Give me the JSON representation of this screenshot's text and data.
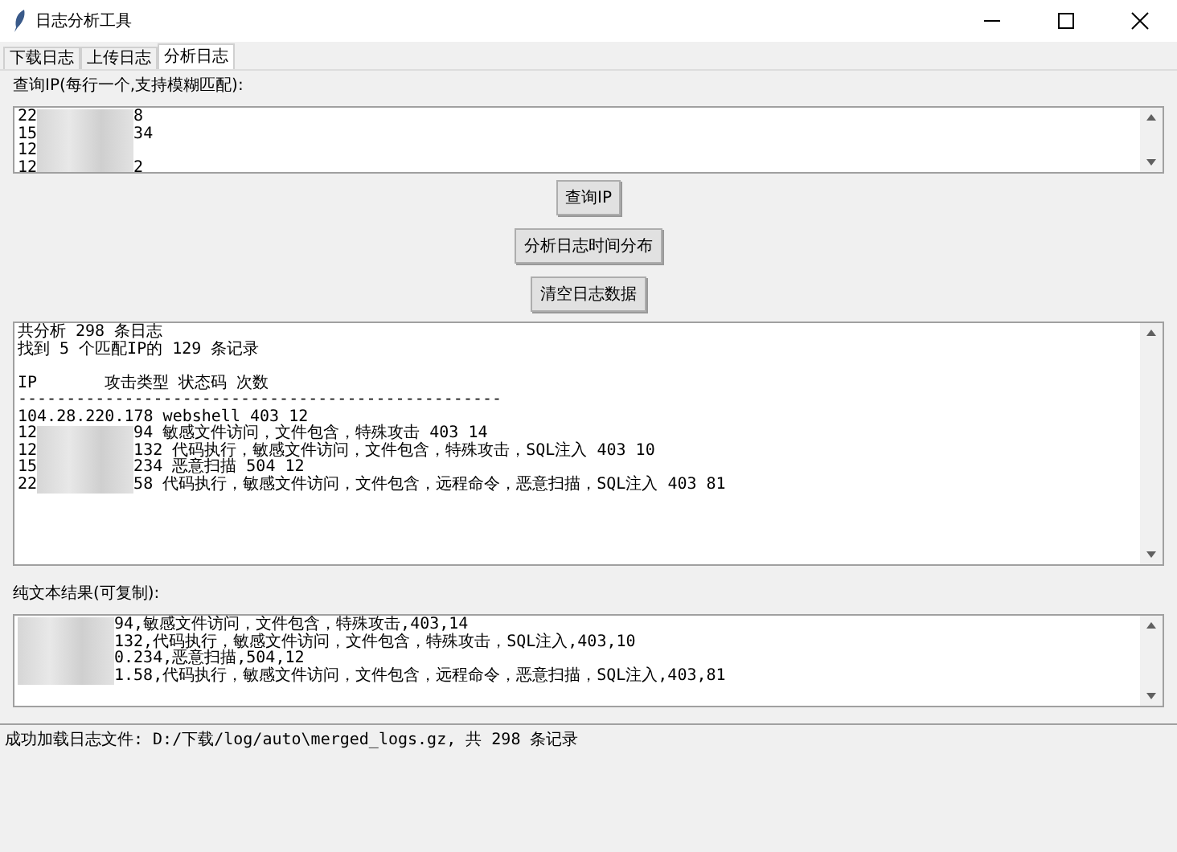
{
  "window": {
    "title": "日志分析工具"
  },
  "tabs": [
    {
      "label": "下载日志",
      "selected": false
    },
    {
      "label": "上传日志",
      "selected": false
    },
    {
      "label": "分析日志",
      "selected": true
    }
  ],
  "ip_query": {
    "label": "查询IP(每行一个,支持模糊匹配):",
    "lines": [
      {
        "head": "22",
        "redacted": true,
        "tail": "8"
      },
      {
        "head": "15",
        "redacted": true,
        "tail": "34"
      },
      {
        "head": "12",
        "redacted": true
      },
      {
        "head": "12",
        "redacted": true,
        "tail": "2"
      }
    ]
  },
  "buttons": [
    "查询IP",
    "分析日志时间分布",
    "清空日志数据"
  ],
  "results": {
    "lines": [
      {
        "head": "共分析 298 条日志"
      },
      {
        "head": "找到 5 个匹配IP的 129 条记录"
      },
      {
        "blank_before": true,
        "head": "IP       攻击类型 状态码 次数"
      },
      {
        "head": "--------------------------------------------------"
      },
      {
        "head": "104.28.220.178 webshell 403 12"
      },
      {
        "head": "12",
        "redacted": true,
        "tail": "94 敏感文件访问，文件包含，特殊攻击 403 14"
      },
      {
        "head": "12",
        "redacted": true,
        "tail": "132 代码执行，敏感文件访问，文件包含，特殊攻击，SQL注入 403 10"
      },
      {
        "head": "15",
        "redacted": true,
        "tail": "234 恶意扫描 504 12"
      },
      {
        "head": "22",
        "redacted": true,
        "tail": "58 代码执行，敏感文件访问，文件包含，远程命令，恶意扫描，SQL注入 403 81"
      }
    ]
  },
  "plain_text": {
    "label": "纯文本结果(可复制):",
    "lines": [
      {
        "redacted": true,
        "tail": "94,敏感文件访问，文件包含，特殊攻击,403,14"
      },
      {
        "redacted": true,
        "tail": "132,代码执行，敏感文件访问，文件包含，特殊攻击，SQL注入,403,10"
      },
      {
        "redacted": true,
        "tail": "0.234,恶意扫描,504,12"
      },
      {
        "redacted": true,
        "tail": "1.58,代码执行，敏感文件访问，文件包含，远程命令，恶意扫描，SQL注入,403,81"
      }
    ]
  },
  "status_log": {
    "text": "成功加载日志文件: D:/下载/log/auto\\merged_logs.gz, 共 298 条记录"
  }
}
